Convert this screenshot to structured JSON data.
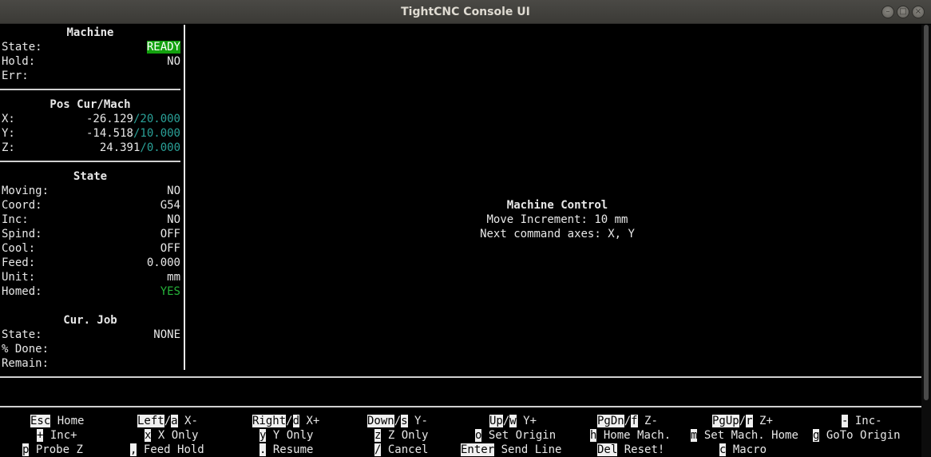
{
  "window": {
    "title": "TightCNC Console UI"
  },
  "machine": {
    "header": "Machine",
    "state_label": "State:",
    "state_value": "READY",
    "hold_label": "Hold:",
    "hold_value": "NO",
    "err_label": "Err:",
    "err_value": ""
  },
  "pos": {
    "header": "Pos Cur/Mach",
    "x_label": "X:",
    "x_cur": "-26.129",
    "x_mach": "/20.000",
    "y_label": "Y:",
    "y_cur": "-14.518",
    "y_mach": "/10.000",
    "z_label": "Z:",
    "z_cur": "24.391",
    "z_mach": "/0.000"
  },
  "state": {
    "header": "State",
    "moving_label": "Moving:",
    "moving_value": "NO",
    "coord_label": "Coord:",
    "coord_value": "G54",
    "inc_label": "Inc:",
    "inc_value": "NO",
    "spind_label": "Spind:",
    "spind_value": "OFF",
    "cool_label": "Cool:",
    "cool_value": "OFF",
    "feed_label": "Feed:",
    "feed_value": "0.000",
    "unit_label": "Unit:",
    "unit_value": "mm",
    "homed_label": "Homed:",
    "homed_value": "YES"
  },
  "job": {
    "header": "Cur. Job",
    "state_label": "State:",
    "state_value": "NONE",
    "done_label": "% Done:",
    "remain_label": "Remain:"
  },
  "main": {
    "title": "Machine Control",
    "increment": "Move Increment: 10 mm",
    "axes": "Next command axes: X, Y"
  },
  "keys": {
    "esc": {
      "k": "Esc",
      "t": " Home"
    },
    "left": {
      "k1": "Left",
      "sep": "/",
      "k2": "a",
      "t": " X-"
    },
    "right": {
      "k1": "Right",
      "sep": "/",
      "k2": "d",
      "t": " X+"
    },
    "down": {
      "k1": "Down",
      "sep": "/",
      "k2": "s",
      "t": " Y-"
    },
    "up": {
      "k1": "Up",
      "sep": "/",
      "k2": "w",
      "t": " Y+"
    },
    "pgdn": {
      "k1": "PgDn",
      "sep": "/",
      "k2": "f",
      "t": " Z-"
    },
    "pgup": {
      "k1": "PgUp",
      "sep": "/",
      "k2": "r",
      "t": " Z+"
    },
    "minus": {
      "k": "-",
      "t": " Inc-"
    },
    "plus": {
      "k": "+",
      "t": " Inc+"
    },
    "x_only": {
      "k": "x",
      "t": " X Only"
    },
    "y_only": {
      "k": "y",
      "t": " Y Only"
    },
    "z_only": {
      "k": "z",
      "t": " Z Only"
    },
    "set_origin": {
      "k": "o",
      "t": " Set Origin"
    },
    "home_mach": {
      "k": "h",
      "t": " Home Mach."
    },
    "set_mach_home": {
      "k": "m",
      "t": " Set Mach. Home"
    },
    "goto_origin": {
      "k": "g",
      "t": " GoTo Origin"
    },
    "probe_z": {
      "k": "p",
      "t": " Probe Z"
    },
    "feed_hold": {
      "k": ",",
      "t": " Feed Hold"
    },
    "resume": {
      "k": ".",
      "t": " Resume"
    },
    "cancel": {
      "k": "/",
      "t": " Cancel"
    },
    "send_line": {
      "k": "Enter",
      "t": " Send Line"
    },
    "reset": {
      "k": "Del",
      "t": " Reset!"
    },
    "macro": {
      "k": "c",
      "t": " Macro"
    }
  }
}
